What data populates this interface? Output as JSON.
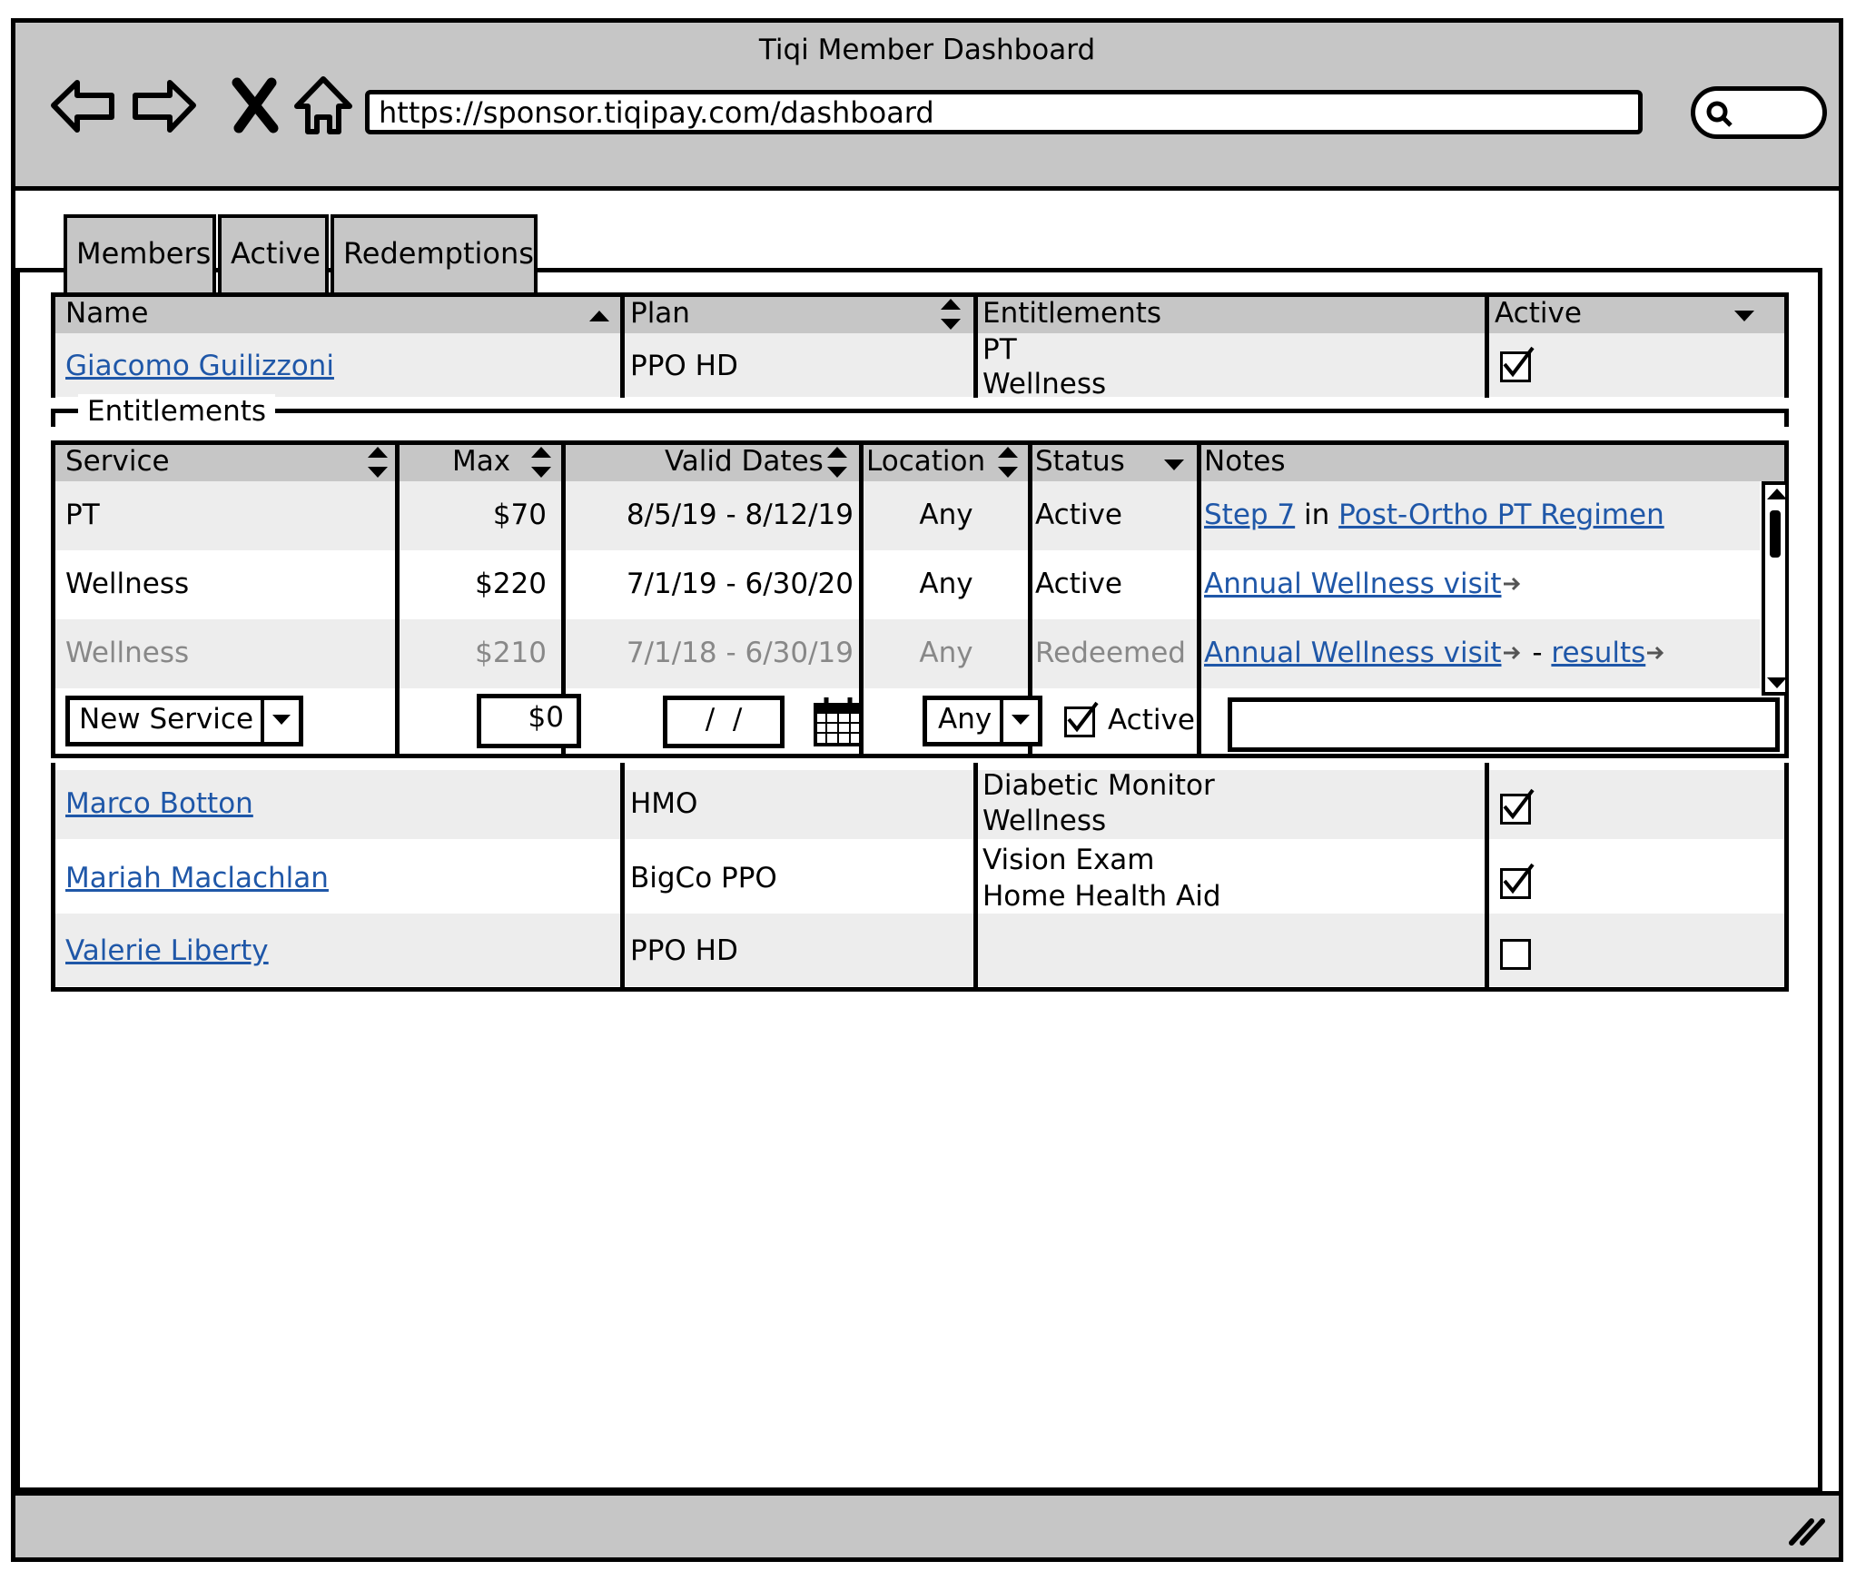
{
  "window": {
    "title": "Tiqi Member Dashboard",
    "url": "https://sponsor.tiqipay.com/dashboard"
  },
  "tabs": [
    "Members",
    "Active",
    "Redemptions"
  ],
  "members_table": {
    "headers": {
      "name": "Name",
      "plan": "Plan",
      "entitlements": "Entitlements",
      "active": "Active"
    },
    "selected": {
      "name": "Giacomo Guilizzoni",
      "plan": "PPO HD",
      "entitlements": [
        "PT",
        "Wellness"
      ],
      "active": true
    },
    "rows": [
      {
        "name": "Marco Botton",
        "plan": "HMO",
        "entitlements": [
          "Diabetic Monitor",
          "Wellness"
        ],
        "active": true
      },
      {
        "name": "Mariah Maclachlan",
        "plan": "BigCo PPO",
        "entitlements": [
          "Vision Exam",
          "Home Health Aid"
        ],
        "active": true
      },
      {
        "name": "Valerie Liberty",
        "plan": "PPO HD",
        "entitlements": [
          "",
          ""
        ],
        "active": false
      }
    ]
  },
  "entitlements_panel": {
    "legend": "Entitlements",
    "headers": {
      "service": "Service",
      "max": "Max",
      "valid_dates": "Valid Dates",
      "location": "Location",
      "status": "Status",
      "notes": "Notes"
    },
    "rows": [
      {
        "service": "PT",
        "max": "$70",
        "dates": "8/5/19 - 8/12/19",
        "location": "Any",
        "status": "Active",
        "note_link1": "Step 7",
        "note_mid": " in ",
        "note_link2": "Post-Ortho PT Regimen"
      },
      {
        "service": "Wellness",
        "max": "$220",
        "dates": "7/1/19 - 6/30/20",
        "location": "Any",
        "status": "Active",
        "note_link1": "Annual Wellness visit",
        "note_mid": "",
        "note_link2": ""
      },
      {
        "service": "Wellness",
        "max": "$210",
        "dates": "7/1/18 - 6/30/19",
        "location": "Any",
        "status": "Redeemed",
        "note_link1": "Annual Wellness visit",
        "note_mid": " - ",
        "note_link2": "results"
      }
    ],
    "new_row": {
      "service": "New Service",
      "max": "$0",
      "date": " /  / ",
      "location": "Any",
      "active_label": "Active",
      "active_checked": true,
      "notes": ""
    }
  },
  "icons": [
    "back-arrow-icon",
    "forward-arrow-icon",
    "stop-icon",
    "home-icon",
    "search-icon",
    "calendar-icon",
    "external-link-icon",
    "resize-grip-icon"
  ]
}
